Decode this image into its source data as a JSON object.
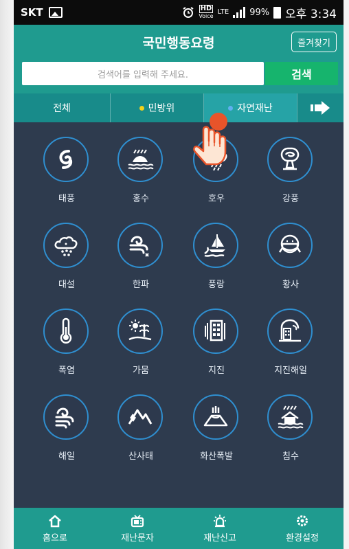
{
  "status": {
    "carrier": "SKT",
    "battery": "99%",
    "time": "오후 3:34",
    "hd_label": "HD",
    "voice_label": "Voice",
    "lte_label": "LTE"
  },
  "header": {
    "title": "국민행동요령",
    "fav_button": "즐겨찾기"
  },
  "search": {
    "placeholder": "검색어를 입력해 주세요.",
    "button": "검색"
  },
  "tabs": [
    {
      "label": "전체"
    },
    {
      "label": "민방위",
      "dot_color": "#f2d21a"
    },
    {
      "label": "자연재난",
      "dot_color": "#5fb0f0",
      "selected": true
    }
  ],
  "grid": [
    {
      "label": "태풍",
      "icon": "typhoon-icon"
    },
    {
      "label": "홍수",
      "icon": "flood-icon"
    },
    {
      "label": "호우",
      "icon": "heavy-rain-icon"
    },
    {
      "label": "강풍",
      "icon": "strong-wind-icon"
    },
    {
      "label": "대설",
      "icon": "heavy-snow-icon"
    },
    {
      "label": "한파",
      "icon": "cold-wave-icon"
    },
    {
      "label": "풍랑",
      "icon": "high-waves-icon"
    },
    {
      "label": "황사",
      "icon": "yellow-dust-icon"
    },
    {
      "label": "폭염",
      "icon": "heat-wave-icon"
    },
    {
      "label": "가뭄",
      "icon": "drought-icon"
    },
    {
      "label": "지진",
      "icon": "earthquake-icon"
    },
    {
      "label": "지진해일",
      "icon": "tsunami-icon"
    },
    {
      "label": "해일",
      "icon": "storm-surge-icon"
    },
    {
      "label": "산사태",
      "icon": "landslide-icon"
    },
    {
      "label": "화산폭발",
      "icon": "volcano-icon"
    },
    {
      "label": "침수",
      "icon": "inundation-icon"
    }
  ],
  "bottom_nav": [
    {
      "label": "홈으로",
      "icon": "home-icon"
    },
    {
      "label": "재난문자",
      "icon": "tv-icon"
    },
    {
      "label": "재난신고",
      "icon": "siren-icon"
    },
    {
      "label": "환경설정",
      "icon": "settings-icon"
    }
  ],
  "colors": {
    "accent": "#1f9b8f",
    "background": "#2e3b4e",
    "circle_border": "#2f8fd0",
    "search_button": "#16b46d"
  }
}
